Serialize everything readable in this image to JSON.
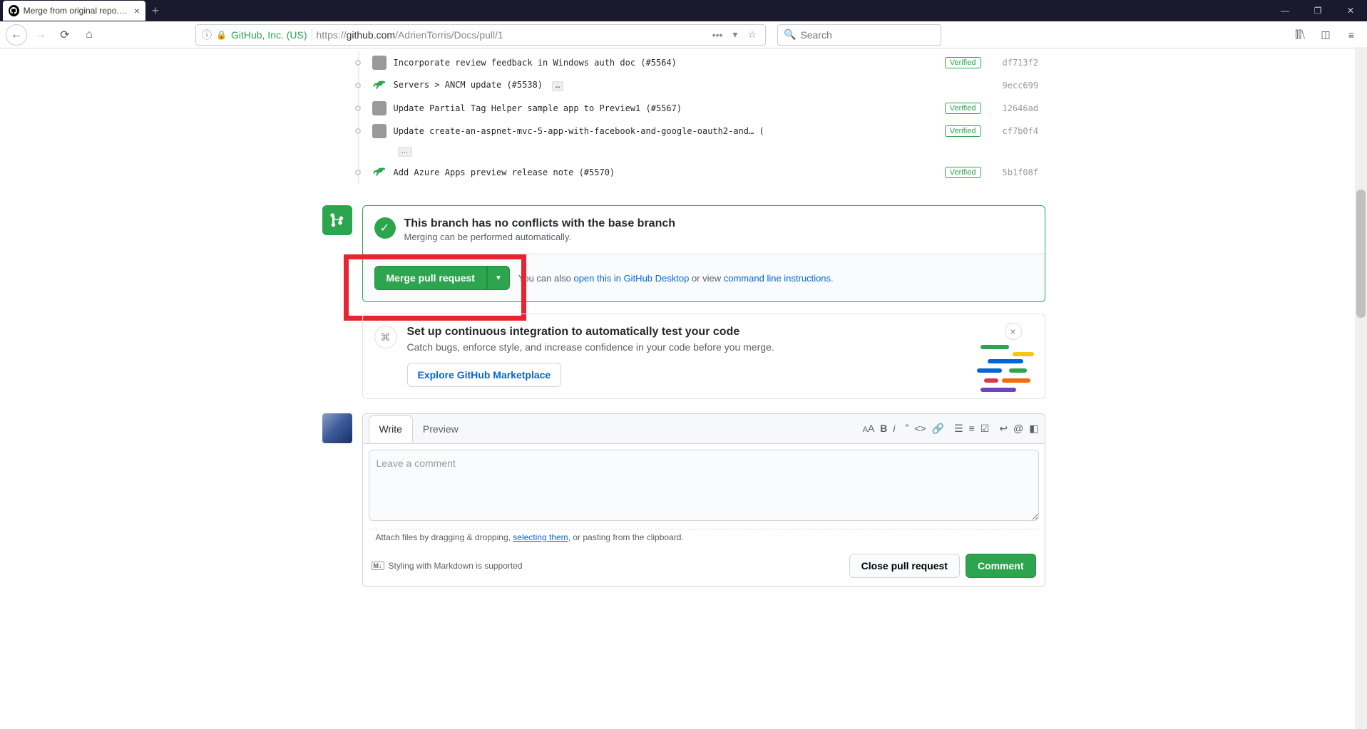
{
  "window": {
    "tab_title": "Merge from original repo. by A",
    "minimize": "—",
    "maximize": "❐",
    "close": "✕"
  },
  "browser": {
    "org": "GitHub, Inc. (US)",
    "url_prefix": "https://",
    "url_domain": "github.com",
    "url_path": "/AdrienTorris/Docs/pull/1",
    "search_placeholder": "Search"
  },
  "commits": [
    {
      "avatar": "photo",
      "msg": "Incorporate review feedback in Windows auth doc (#5564)",
      "ellipsis": false,
      "verified": true,
      "sha": "df713f2"
    },
    {
      "avatar": "dino",
      "msg": "Servers > ANCM update (#5538)",
      "ellipsis": true,
      "verified": false,
      "sha": "9ecc699"
    },
    {
      "avatar": "photo",
      "msg": "Update Partial Tag Helper sample app to Preview1 (#5567)",
      "ellipsis": false,
      "verified": true,
      "sha": "12646ad"
    },
    {
      "avatar": "photo",
      "msg": "Update create-an-aspnet-mvc-5-app-with-facebook-and-google-oauth2-and… (",
      "ellipsis": true,
      "ellipsis_below": true,
      "verified": true,
      "sha": "cf7b0f4"
    },
    {
      "avatar": "dino",
      "msg": "Add Azure Apps preview release note (#5570)",
      "ellipsis": false,
      "verified": true,
      "sha": "5b1f08f"
    }
  ],
  "merge": {
    "title": "This branch has no conflicts with the base branch",
    "subtitle": "Merging can be performed automatically.",
    "button": "Merge pull request",
    "hint_prefix": "You can also ",
    "hint_link1": "open this in GitHub Desktop",
    "hint_mid": " or view ",
    "hint_link2": "command line instructions",
    "hint_suffix": "."
  },
  "ci": {
    "title": "Set up continuous integration to automatically test your code",
    "subtitle": "Catch bugs, enforce style, and increase confidence in your code before you merge.",
    "button": "Explore GitHub Marketplace"
  },
  "comment": {
    "tab_write": "Write",
    "tab_preview": "Preview",
    "placeholder": "Leave a comment",
    "attach_prefix": "Attach files by dragging & dropping, ",
    "attach_link": "selecting them",
    "attach_suffix": ", or pasting from the clipboard.",
    "md_hint": "Styling with Markdown is supported",
    "close_btn": "Close pull request",
    "comment_btn": "Comment"
  }
}
